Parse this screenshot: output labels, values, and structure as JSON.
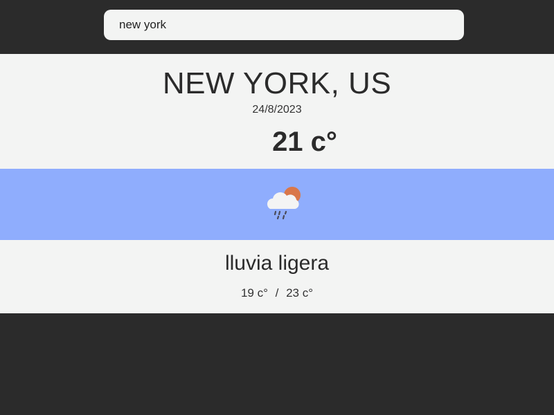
{
  "search": {
    "value": "new york",
    "placeholder": ""
  },
  "weather": {
    "location": "NEW YORK, US",
    "date": "24/8/2023",
    "temperature": "21 c°",
    "icon": "cloud-sun-rain-icon",
    "description": "lluvia ligera",
    "min": "19 c°",
    "separator": "/",
    "max": "23 c°"
  },
  "colors": {
    "background": "#2b2b2b",
    "panel": "#f3f4f3",
    "icon_band": "#8fadfd",
    "sun": "#d9774a",
    "cloud": "#f4f4f4",
    "rain": "#4a4a58"
  }
}
